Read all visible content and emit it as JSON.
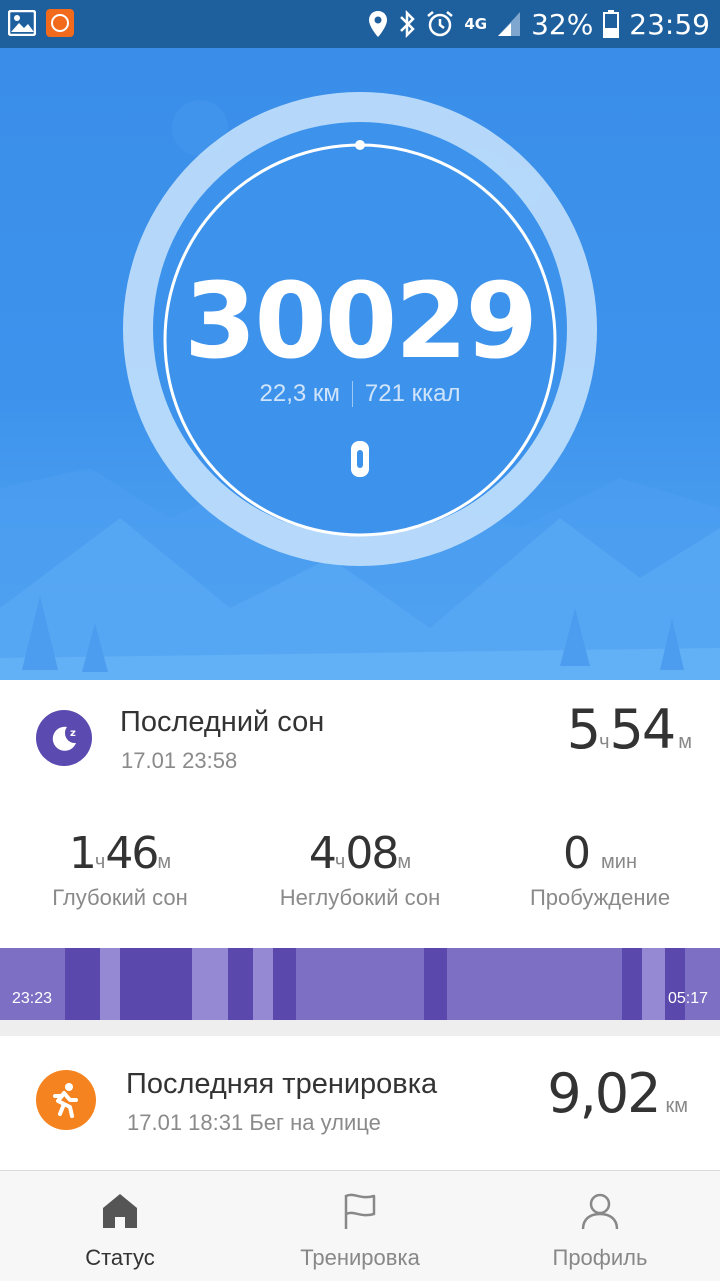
{
  "status_bar": {
    "network": "4G",
    "battery": "32%",
    "time": "23:59"
  },
  "hero": {
    "steps": "30029",
    "distance": "22,3 км",
    "calories": "721 ккал"
  },
  "sleep_card": {
    "title": "Последний сон",
    "datetime": "17.01 23:58",
    "total_hours": "5",
    "hours_unit": "ч",
    "total_minutes": "54",
    "minutes_unit": "м",
    "stats": [
      {
        "h": "1",
        "hu": "ч",
        "m": "46",
        "mu": "м",
        "label": "Глубокий сон"
      },
      {
        "h": "4",
        "hu": "ч",
        "m": "08",
        "mu": "м",
        "label": "Неглубокий сон"
      },
      {
        "value": "0",
        "unit": "мин",
        "label": "Пробуждение"
      }
    ],
    "start_time": "23:23",
    "end_time": "05:17"
  },
  "workout_card": {
    "title": "Последняя тренировка",
    "subtitle": "17.01 18:31 Бег на улице",
    "value": "9,02",
    "unit": "км"
  },
  "nav": {
    "status": "Статус",
    "workout": "Тренировка",
    "profile": "Профиль"
  },
  "colors": {
    "accent": "#3a8ee9",
    "sleep": "#5b4bb0",
    "run": "#f5831f"
  }
}
